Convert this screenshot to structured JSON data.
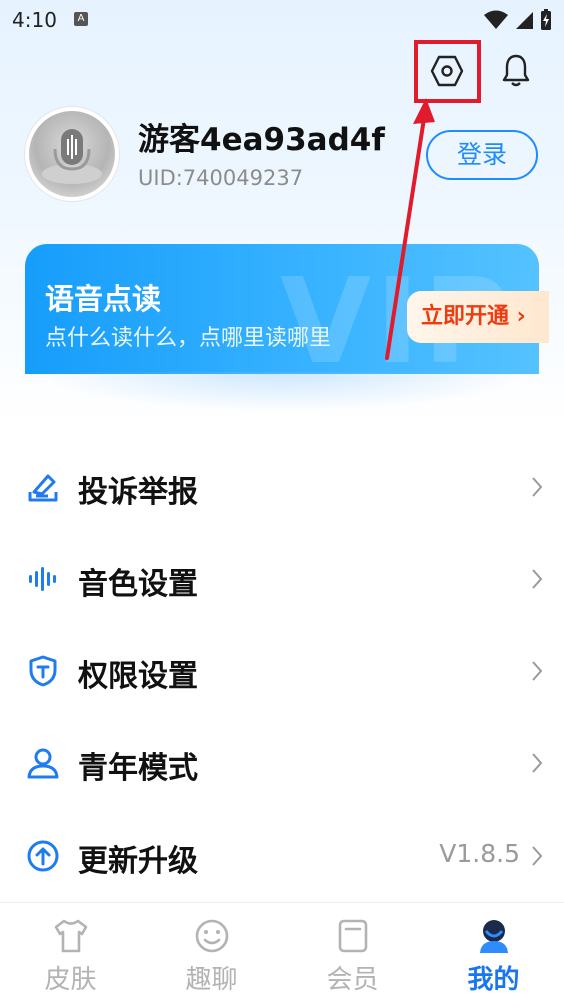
{
  "status_bar": {
    "time": "4:10",
    "notif_letter": "A"
  },
  "profile": {
    "username": "游客4ea93ad4f",
    "uid": "UID:740049237",
    "login_label": "登录"
  },
  "vip_banner": {
    "title": "语音点读",
    "subtitle": "点什么读什么，点哪里读哪里",
    "cta_label": "立即开通",
    "watermark": "VIP"
  },
  "menu": {
    "items": [
      {
        "label": "投诉举报",
        "icon": "report-icon"
      },
      {
        "label": "音色设置",
        "icon": "voice-wave-icon"
      },
      {
        "label": "权限设置",
        "icon": "shield-icon"
      },
      {
        "label": "青年模式",
        "icon": "person-icon"
      },
      {
        "label": "更新升级",
        "icon": "upload-arrow-icon",
        "value": "V1.8.5"
      }
    ]
  },
  "tabs": [
    {
      "label": "皮肤",
      "icon": "shirt-icon",
      "active": false
    },
    {
      "label": "趣聊",
      "icon": "smile-icon",
      "active": false
    },
    {
      "label": "会员",
      "icon": "member-card-icon",
      "active": false
    },
    {
      "label": "我的",
      "icon": "profile-icon",
      "active": true
    }
  ],
  "colors": {
    "accent": "#1f8bff",
    "annotation": "#e21b2c",
    "cta_text": "#ee3b10"
  }
}
